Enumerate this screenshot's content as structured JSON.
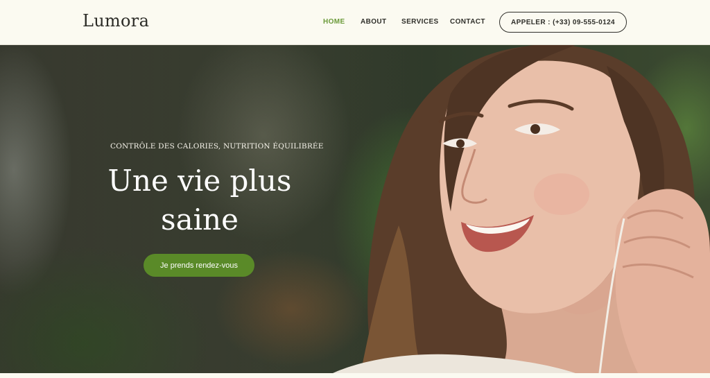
{
  "brand": {
    "name": "Lumora"
  },
  "nav": {
    "items": [
      {
        "label": "HOME",
        "active": true
      },
      {
        "label": "ABOUT",
        "active": false
      },
      {
        "label": "SERVICES",
        "active": false
      },
      {
        "label": "CONTACT",
        "active": false
      }
    ],
    "call_button": "APPELER : (+33) 09-555-0124"
  },
  "hero": {
    "eyebrow": "CONTRÔLE DES CALORIES, NUTRITION ÉQUILIBRÉE",
    "title_line1": "Une vie plus",
    "title_line2": "saine",
    "cta_label": "Je prends rendez-vous",
    "image": "smiling-woman-with-earphones-photo"
  },
  "colors": {
    "background": "#fbfaf1",
    "accent_green": "#5a8a28",
    "nav_active": "#6b9a3a",
    "text_dark": "#2f2f2a"
  }
}
